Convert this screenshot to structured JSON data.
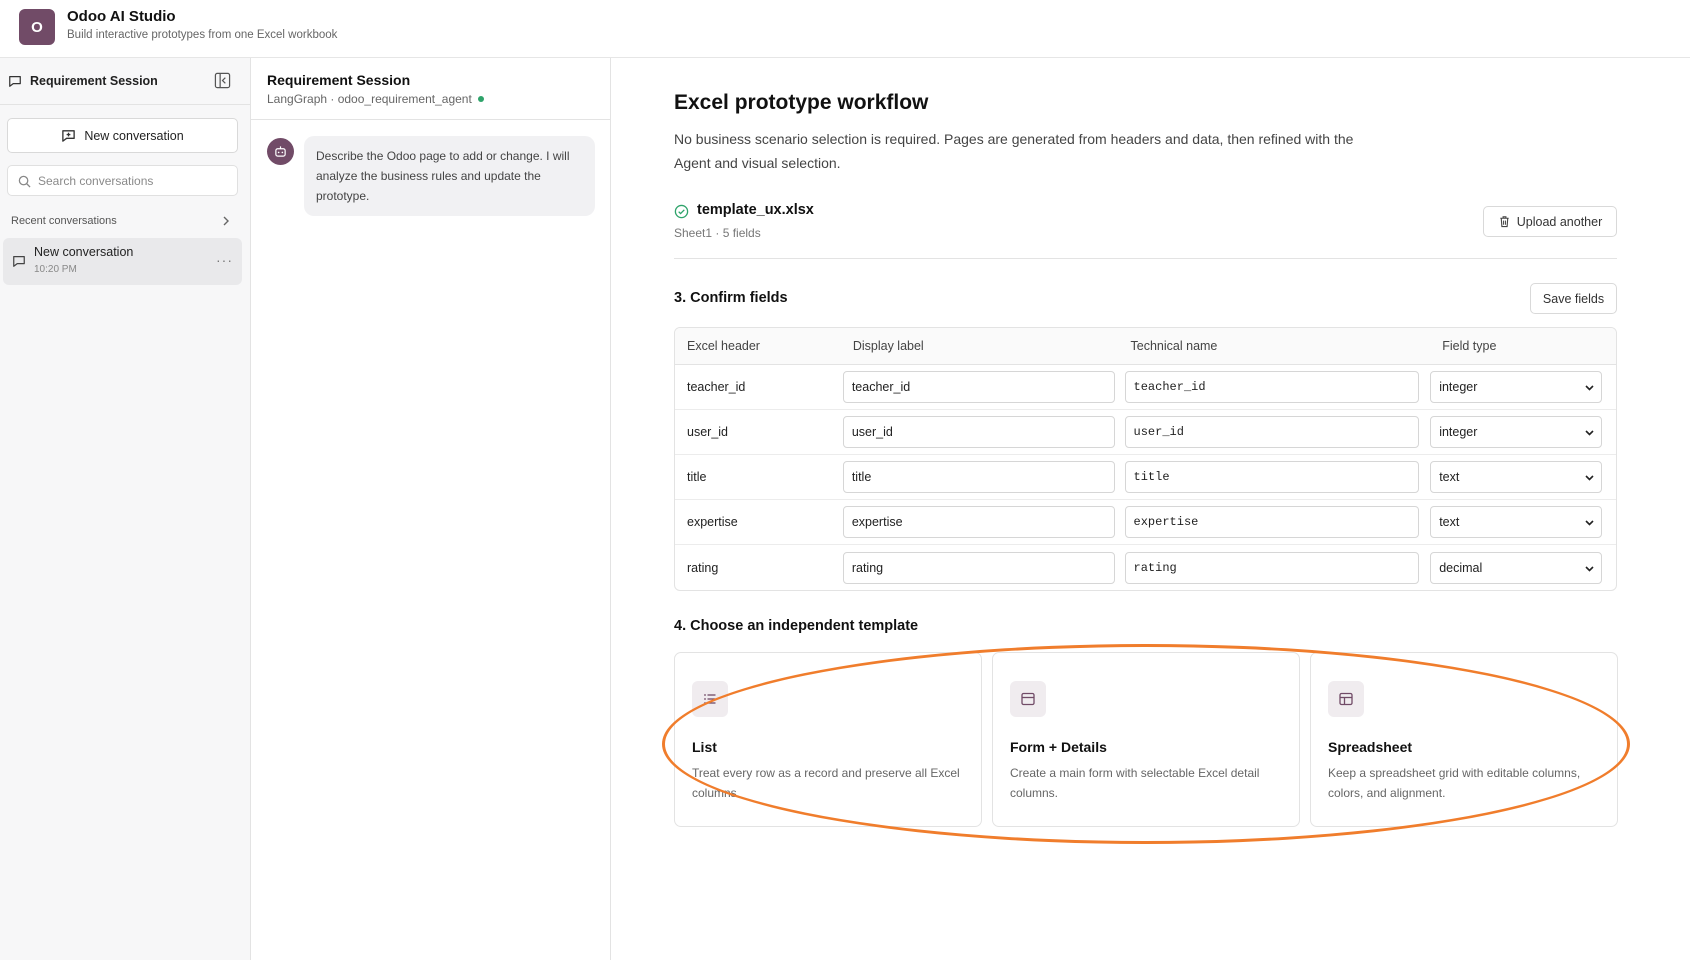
{
  "app": {
    "logo_letter": "O",
    "title": "Odoo AI Studio",
    "subtitle": "Build interactive prototypes from one Excel workbook",
    "brand_color": "#714b67"
  },
  "sidebar": {
    "title": "Requirement Session",
    "new_conversation_label": "New conversation",
    "search_placeholder": "Search conversations",
    "recent_label": "Recent conversations",
    "conversations": [
      {
        "title": "New conversation",
        "time": "10:20 PM"
      }
    ]
  },
  "chat": {
    "title": "Requirement Session",
    "subtitle": "LangGraph · odoo_requirement_agent",
    "status_color": "#2ea36a",
    "message": "Describe the Odoo page to add or change. I will analyze the business rules and update the prototype."
  },
  "main": {
    "title": "Excel prototype workflow",
    "description": "No business scenario selection is required. Pages are generated from headers and data, then refined with the Agent and visual selection.",
    "file": {
      "name": "template_ux.xlsx",
      "meta": "Sheet1 · 5 fields",
      "upload_label": "Upload another"
    },
    "confirm": {
      "title": "3. Confirm fields",
      "save_label": "Save fields",
      "headers": [
        "Excel header",
        "Display label",
        "Technical name",
        "Field type"
      ],
      "rows": [
        {
          "excel": "teacher_id",
          "label": "teacher_id",
          "tech": "teacher_id",
          "type": "integer"
        },
        {
          "excel": "user_id",
          "label": "user_id",
          "tech": "user_id",
          "type": "integer"
        },
        {
          "excel": "title",
          "label": "title",
          "tech": "title",
          "type": "text"
        },
        {
          "excel": "expertise",
          "label": "expertise",
          "tech": "expertise",
          "type": "text"
        },
        {
          "excel": "rating",
          "label": "rating",
          "tech": "rating",
          "type": "decimal"
        }
      ]
    },
    "templates": {
      "title": "4. Choose an independent template",
      "items": [
        {
          "icon": "list-icon",
          "name": "List",
          "desc": "Treat every row as a record and preserve all Excel columns."
        },
        {
          "icon": "form-icon",
          "name": "Form + Details",
          "desc": "Create a main form with selectable Excel detail columns."
        },
        {
          "icon": "spreadsheet-icon",
          "name": "Spreadsheet",
          "desc": "Keep a spreadsheet grid with editable columns, colors, and alignment."
        }
      ],
      "highlight_color": "#f07d2c"
    }
  }
}
